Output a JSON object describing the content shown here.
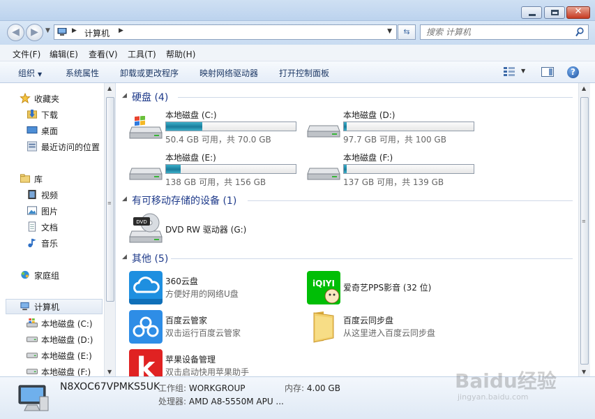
{
  "window": {
    "minimize_label": "",
    "close_label": "✕"
  },
  "address": {
    "path": "计算机",
    "search_placeholder": "搜索 计算机"
  },
  "menu": [
    "文件(F)",
    "编辑(E)",
    "查看(V)",
    "工具(T)",
    "帮助(H)"
  ],
  "toolbar": {
    "organize": "组织",
    "system_properties": "系统属性",
    "uninstall": "卸载或更改程序",
    "map_drive": "映射网络驱动器",
    "control_panel": "打开控制面板"
  },
  "nav": {
    "favorites": "收藏夹",
    "downloads": "下载",
    "desktop": "桌面",
    "recent": "最近访问的位置",
    "libraries": "库",
    "videos": "视频",
    "pictures": "图片",
    "documents": "文档",
    "music": "音乐",
    "homegroup": "家庭组",
    "computer": "计算机",
    "drive_c": "本地磁盘 (C:)",
    "drive_d": "本地磁盘 (D:)",
    "drive_e": "本地磁盘 (E:)",
    "drive_f": "本地磁盘 (F:)"
  },
  "groups": {
    "hard_disks": "硬盘 (4)",
    "removable": "有可移动存储的设备 (1)",
    "other": "其他 (5)"
  },
  "drives": [
    {
      "name": "本地磁盘 (C:)",
      "free": "50.4 GB 可用，共 70.0 GB",
      "used_fraction": 0.28
    },
    {
      "name": "本地磁盘 (D:)",
      "free": "97.7 GB 可用，共 100 GB",
      "used_fraction": 0.023
    },
    {
      "name": "本地磁盘 (E:)",
      "free": "138 GB 可用，共 156 GB",
      "used_fraction": 0.115
    },
    {
      "name": "本地磁盘 (F:)",
      "free": "137 GB 可用，共 139 GB",
      "used_fraction": 0.014
    }
  ],
  "dvd": {
    "name": "DVD RW 驱动器 (G:)",
    "badge": "DVD"
  },
  "apps": [
    {
      "name": "360云盘",
      "desc": "方便好用的网络U盘"
    },
    {
      "name": "爱奇艺PPS影音 (32 位)",
      "desc": ""
    },
    {
      "name": "百度云管家",
      "desc": "双击运行百度云管家"
    },
    {
      "name": "百度云同步盘",
      "desc": "从这里进入百度云同步盘"
    },
    {
      "name": "苹果设备管理",
      "desc": "双击启动快用苹果助手"
    }
  ],
  "app_badges": {
    "iqiyi": "iQIYI",
    "kuaiyong": "k"
  },
  "details": {
    "computer_name": "N8XOC67VPMKS5UK",
    "workgroup_label": "工作组:",
    "workgroup_value": "WORKGROUP",
    "memory_label": "内存:",
    "memory_value": "4.00 GB",
    "cpu_label": "处理器:",
    "cpu_value": "AMD A8-5550M APU ..."
  },
  "watermark": {
    "main": "Baidu经验",
    "sub": "jingyan.baidu.com"
  },
  "colors": {
    "accent": "#1e3a8a",
    "drive_fill": "#1a7c9b",
    "cloud360": "#1e8fe0",
    "iqiyi": "#00be06",
    "baidu_cloud": "#2e8de6",
    "kuaiyong": "#e02222"
  }
}
